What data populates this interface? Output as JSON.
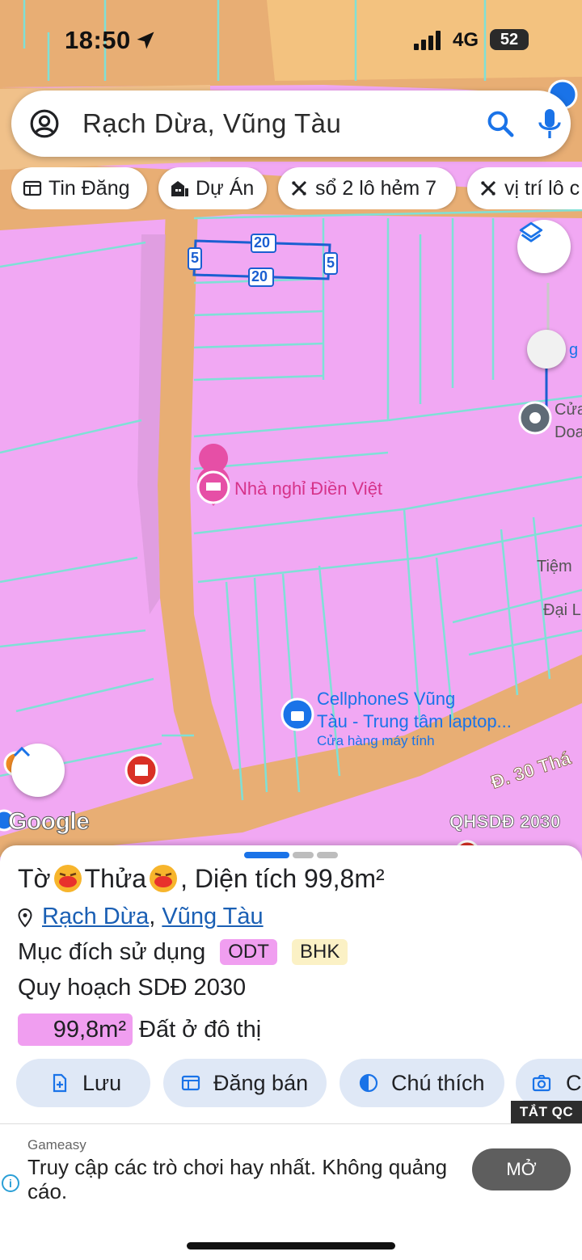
{
  "status_bar": {
    "time": "18:50",
    "network": "4G",
    "battery": "52"
  },
  "search": {
    "query": "Rạch Dừa, Vũng Tàu"
  },
  "chips": [
    {
      "label": "Tin Đăng",
      "icon": "listing-icon"
    },
    {
      "label": "Dự Án",
      "icon": "building-icon"
    },
    {
      "label": "sổ 2 lô hẻm 7",
      "icon": "ruler-icon"
    },
    {
      "label": "vị trí lô c",
      "icon": "ruler-icon"
    }
  ],
  "map": {
    "dimension_labels": {
      "top": "20",
      "bottom": "20",
      "left": "5",
      "right": "5"
    },
    "poi_guesthouse": "Nhà nghỉ Điền Việt",
    "poi_store_line1": "CellphoneS Vũng",
    "poi_store_line2": "Tàu - Trung tâm laptop...",
    "poi_store_category": "Cửa hàng máy tính",
    "edge_label_1": "Cửa",
    "edge_label_2": "Doa",
    "edge_label_3": "Tiệm",
    "edge_label_4": "Đại L",
    "edge_label_5": "g",
    "road_label": "Đ. 30 Thá",
    "google": "Google",
    "plan_layer": "QHSDĐ 2030",
    "colors": {
      "residential": "#f1a8f3",
      "road": "#e8ae74",
      "parcel_line": "#7fe0d6"
    }
  },
  "sheet": {
    "title_prefix": "Tờ",
    "title_mid": "Thửa",
    "title_suffix": ", Diện tích 99,8m²",
    "location_part1": "Rạch Dừa",
    "location_sep": ", ",
    "location_part2": "Vũng Tàu",
    "purpose_label": "Mục đích sử dụng",
    "tag_odt": "ODT",
    "tag_bhk": "BHK",
    "plan_label": "Quy hoạch SDĐ 2030",
    "area_value": "99,8m²",
    "area_type": "Đất ở đô thị",
    "actions": [
      {
        "label": "Lưu",
        "icon": "save-icon"
      },
      {
        "label": "Đăng bán",
        "icon": "post-icon"
      },
      {
        "label": "Chú thích",
        "icon": "legend-icon"
      },
      {
        "label": "C",
        "icon": "camera-icon"
      }
    ]
  },
  "ad": {
    "close_label": "TẮT QC",
    "brand": "Gameasy",
    "text": "Truy cập các trò chơi hay nhất. Không quảng cáo.",
    "button": "MỞ",
    "info": "i"
  }
}
